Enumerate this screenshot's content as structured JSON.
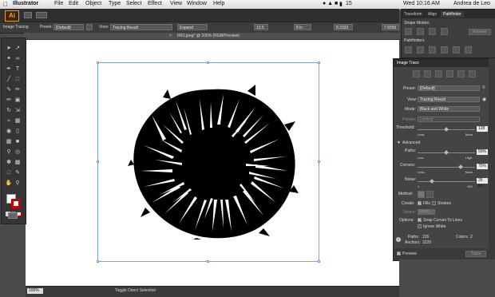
{
  "menubar": {
    "apple": "",
    "app_name": "Illustrator",
    "items": [
      "File",
      "Edit",
      "Object",
      "Type",
      "Select",
      "Effect",
      "View",
      "Window",
      "Help"
    ],
    "battery": "15",
    "datetime": "Wed 10:16 AM",
    "user": "Andrea de Leo"
  },
  "control_bar": {
    "panel_name": "Image Tracing",
    "preset_label": "Preset:",
    "preset_value": "[Default]",
    "view_label": "View:",
    "view_value": "Tracing Result",
    "expand_label": "Expand",
    "field1": "13.5 in",
    "field2": "8 in",
    "field3": "8.3333 in",
    "field4": "7.5556 in"
  },
  "document": {
    "tab_title": "IRIS.jpeg* @ 100% (RGB/Preview)",
    "zoom": "100%",
    "status_text": "Toggle Direct Selection"
  },
  "pathfinder_panel": {
    "tabs": [
      "Transform",
      "Align",
      "Pathfinder"
    ],
    "shape_modes_label": "Shape Modes:",
    "pathfinders_label": "Pathfinders:",
    "expand_button": "Expand"
  },
  "image_trace": {
    "title": "Image Trace",
    "preset_label": "Preset:",
    "preset_value": "[Default]",
    "view_label": "View:",
    "view_value": "Tracing Result",
    "mode_label": "Mode:",
    "mode_value": "Black and White",
    "palette_label": "Palette:",
    "palette_value": "Limited",
    "threshold_label": "Threshold:",
    "threshold_value": "128",
    "threshold_level": 0.5,
    "threshold_less": "Less",
    "threshold_more": "More",
    "advanced_label": "Advanced",
    "paths_label": "Paths:",
    "paths_value": "50%",
    "paths_level": 0.5,
    "paths_low": "Low",
    "paths_high": "High",
    "corners_label": "Corners:",
    "corners_value": "75%",
    "corners_level": 0.75,
    "corners_less": "Less",
    "corners_more": "More",
    "noise_label": "Noise:",
    "noise_value": "25 px",
    "noise_level": 0.25,
    "noise_min": "1",
    "noise_max": "100",
    "method_label": "Method:",
    "create_label": "Create:",
    "fills_label": "Fills",
    "strokes_label": "Strokes",
    "stroke_label": "Stroke:",
    "stroke_value": "10 px",
    "options_label": "Options:",
    "snap_label": "Snap Curves To Lines",
    "ignore_white_label": "Ignore White",
    "paths_count_label": "Paths:",
    "paths_count": "226",
    "colors_count_label": "Colors:",
    "colors_count": "2",
    "anchors_label": "Anchors:",
    "anchors_count": "3226",
    "preview_label": "Preview",
    "trace_button": "Trace"
  },
  "colors": {
    "accent": "#f09a1e",
    "selection": "#7aa4e0"
  }
}
